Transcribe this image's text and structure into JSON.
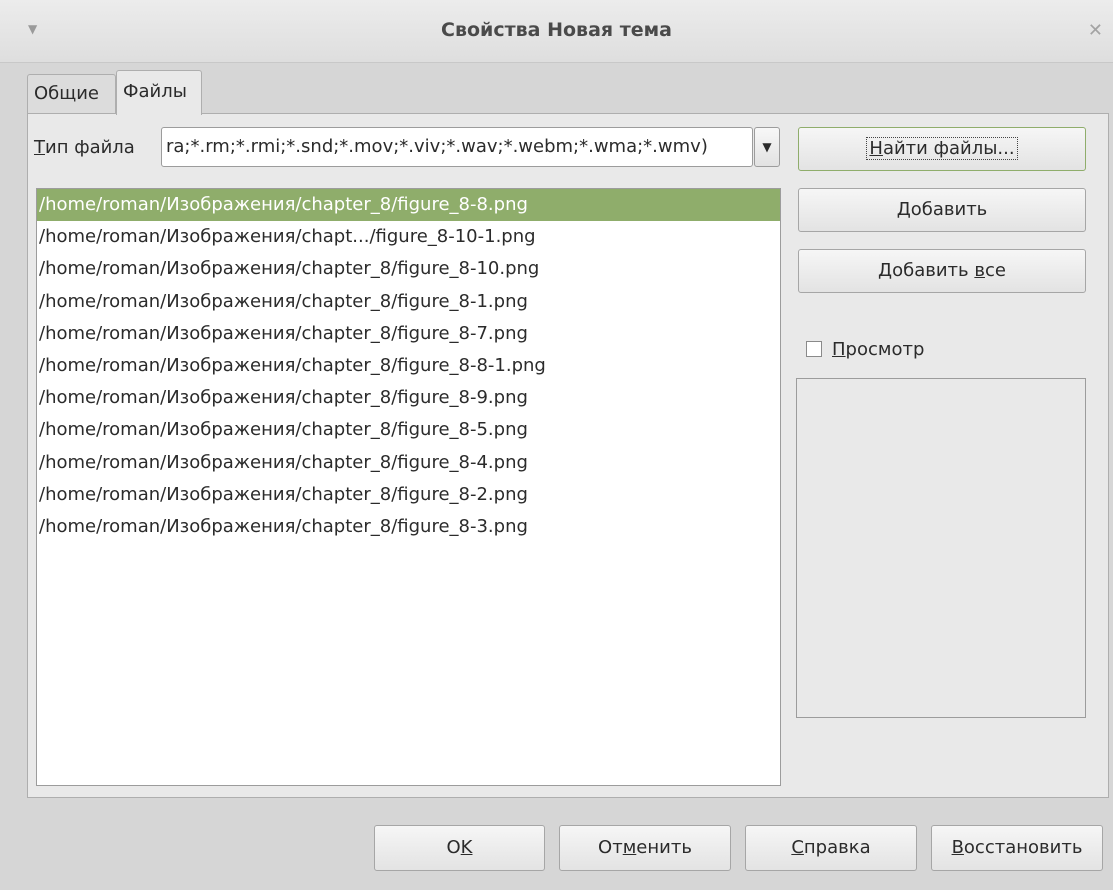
{
  "window": {
    "title": "Свойства Новая тема",
    "menu_icon": "triangle-down-icon",
    "close_icon": "close-icon"
  },
  "tabs": [
    {
      "label": "Общие",
      "active": false
    },
    {
      "label": "Файлы",
      "active": true
    }
  ],
  "file_type": {
    "label_first": "Т",
    "label_rest": "ип файла",
    "value": "ra;*.rm;*.rmi;*.snd;*.mov;*.viv;*.wav;*.webm;*.wma;*.wmv)"
  },
  "files": [
    "/home/roman/Изображения/chapter_8/figure_8-8.png",
    "/home/roman/Изображения/chapt.../figure_8-10-1.png",
    "/home/roman/Изображения/chapter_8/figure_8-10.png",
    "/home/roman/Изображения/chapter_8/figure_8-1.png",
    "/home/roman/Изображения/chapter_8/figure_8-7.png",
    "/home/roman/Изображения/chapter_8/figure_8-8-1.png",
    "/home/roman/Изображения/chapter_8/figure_8-9.png",
    "/home/roman/Изображения/chapter_8/figure_8-5.png",
    "/home/roman/Изображения/chapter_8/figure_8-4.png",
    "/home/roman/Изображения/chapter_8/figure_8-2.png",
    "/home/roman/Изображения/chapter_8/figure_8-3.png"
  ],
  "selected_index": 0,
  "side_buttons": {
    "find": {
      "u": "Н",
      "rest": "айти файлы..."
    },
    "add": {
      "u": "Д",
      "rest": "обавить"
    },
    "add_all": {
      "pre": "Добавить ",
      "u": "в",
      "rest": "се"
    }
  },
  "preview": {
    "u": "П",
    "rest": "росмотр",
    "checked": false
  },
  "colors": {
    "selection": "#8fad6b"
  },
  "bottom_buttons": {
    "ok": {
      "pre": "O",
      "u": "K",
      "rest": ""
    },
    "cancel": {
      "pre": "От",
      "u": "м",
      "rest": "енить"
    },
    "help": {
      "pre": "",
      "u": "С",
      "rest": "правка"
    },
    "reset": {
      "pre": "",
      "u": "В",
      "rest": "осстановить"
    }
  }
}
